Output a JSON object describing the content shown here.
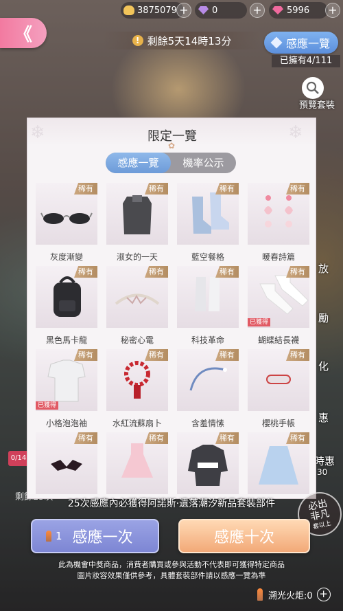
{
  "currency": {
    "gold": "3875079",
    "diamond_purple": "0",
    "diamond_pink": "5996",
    "add_label": "+"
  },
  "header": {
    "back_label": "《",
    "timer": "剩餘5天14時13分",
    "timer_icon": "!",
    "inventory_button": "感應一覽",
    "owned_count": "已擁有4/111",
    "preview_label": "預覽套裝"
  },
  "side_labels": [
    "放",
    "勵",
    "化",
    "惠",
    "時惠",
    "30"
  ],
  "left_hud": {
    "badge": "0/14",
    "remaining": "剩餘25次"
  },
  "modal": {
    "title": "限定一覽",
    "tabs": [
      {
        "label": "感應一覽",
        "active": true
      },
      {
        "label": "機率公示",
        "active": false
      }
    ],
    "rarity_label": "稀有",
    "obtained_label": "已獲得",
    "items": [
      {
        "name": "灰度漸變",
        "icon": "sunglasses-icon",
        "obtained": false
      },
      {
        "name": "淑女的一天",
        "icon": "top-icon",
        "obtained": false
      },
      {
        "name": "藍空餐格",
        "icon": "socks-icon",
        "obtained": false
      },
      {
        "name": "暖春詩篇",
        "icon": "earrings-icon",
        "obtained": false
      },
      {
        "name": "黑色馬卡龍",
        "icon": "backpack-icon",
        "obtained": false
      },
      {
        "name": "秘密心電",
        "icon": "headband-icon",
        "obtained": false
      },
      {
        "name": "科技革命",
        "icon": "boots-icon",
        "obtained": false
      },
      {
        "name": "蝴蝶結長襪",
        "icon": "stockings-icon",
        "obtained": true
      },
      {
        "name": "小格泡泡袖",
        "icon": "blouse-icon",
        "obtained": true
      },
      {
        "name": "水紅流蘇扇卜",
        "icon": "bracelet-icon",
        "obtained": false
      },
      {
        "name": "含羞情愫",
        "icon": "hairband-icon",
        "obtained": false
      },
      {
        "name": "櫻桃手帳",
        "icon": "hairclip-icon",
        "obtained": false
      },
      {
        "name": "",
        "icon": "bat-hairclip-icon",
        "obtained": false
      },
      {
        "name": "",
        "icon": "dress-icon",
        "obtained": false
      },
      {
        "name": "",
        "icon": "sweater-icon",
        "obtained": false
      },
      {
        "name": "",
        "icon": "skirt-icon",
        "obtained": false
      }
    ]
  },
  "bottom": {
    "guarantee": "25次感應內必獲得阿諾斯·遺落潮汐新品套裝部件",
    "stamp_line1": "必出",
    "stamp_line2": "非凡",
    "stamp_line3": "套以上",
    "pull_one": {
      "cost": "1",
      "label": "感應一次"
    },
    "pull_ten": {
      "label": "感應十次"
    },
    "notice1": "此為機會中獎商品，消費者購買或參與活動不代表即可獲得特定商品",
    "notice2": "圖片妝容效果僅供參考，具體套裝部件請以感應一覽為準",
    "torch": "溯光火炬:0"
  }
}
